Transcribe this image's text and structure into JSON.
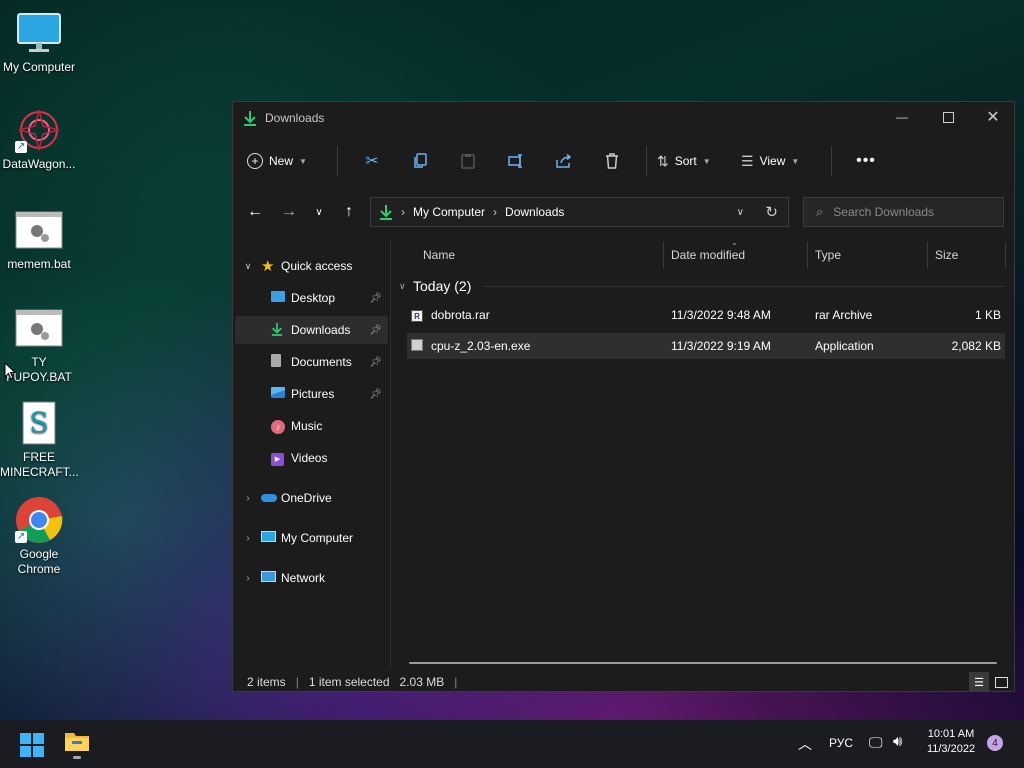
{
  "desktop": {
    "icons": [
      {
        "label": "My Computer",
        "icon": "monitor-icon"
      },
      {
        "label": "DataWagon...",
        "icon": "datawagon-icon"
      },
      {
        "label": "mem​em.bat",
        "icon": "batch-file-icon"
      },
      {
        "label": "TY\nFUPOY.BAT",
        "icon": "batch-file-icon"
      },
      {
        "label": "FREE\nMINECRAFT...",
        "icon": "script-file-icon"
      },
      {
        "label": "Google\nChrome",
        "icon": "chrome-icon"
      }
    ]
  },
  "window": {
    "title": "Downloads",
    "toolbar": {
      "new_label": "New",
      "sort_label": "Sort",
      "view_label": "View"
    },
    "address": {
      "crumbs": [
        "My Computer",
        "Downloads"
      ]
    },
    "search": {
      "placeholder": "Search Downloads"
    },
    "nav": {
      "quick_access": "Quick access",
      "items": [
        {
          "label": "Desktop"
        },
        {
          "label": "Downloads"
        },
        {
          "label": "Documents"
        },
        {
          "label": "Pictures"
        },
        {
          "label": "Music"
        },
        {
          "label": "Videos"
        }
      ],
      "onedrive": "OneDrive",
      "my_computer": "My Computer",
      "network": "Network"
    },
    "columns": {
      "name": "Name",
      "date": "Date modified",
      "type": "Type",
      "size": "Size"
    },
    "group": "Today (2)",
    "files": [
      {
        "name": "dobrota.rar",
        "date": "11/3/2022 9:48 AM",
        "type": "rar Archive",
        "size": "1 KB"
      },
      {
        "name": "cpu-z_2.03-en.exe",
        "date": "11/3/2022 9:19 AM",
        "type": "Application",
        "size": "2,082 KB"
      }
    ],
    "status": {
      "items": "2 items",
      "selected": "1 item selected",
      "size": "2.03 MB"
    }
  },
  "taskbar": {
    "language": "РУС",
    "time": "10:01 AM",
    "date": "11/3/2022",
    "notifications": "4"
  },
  "colors": {
    "accent": "#0078d4",
    "window_bg": "#1c1c1c",
    "taskbar_bg": "#1b1b22"
  }
}
